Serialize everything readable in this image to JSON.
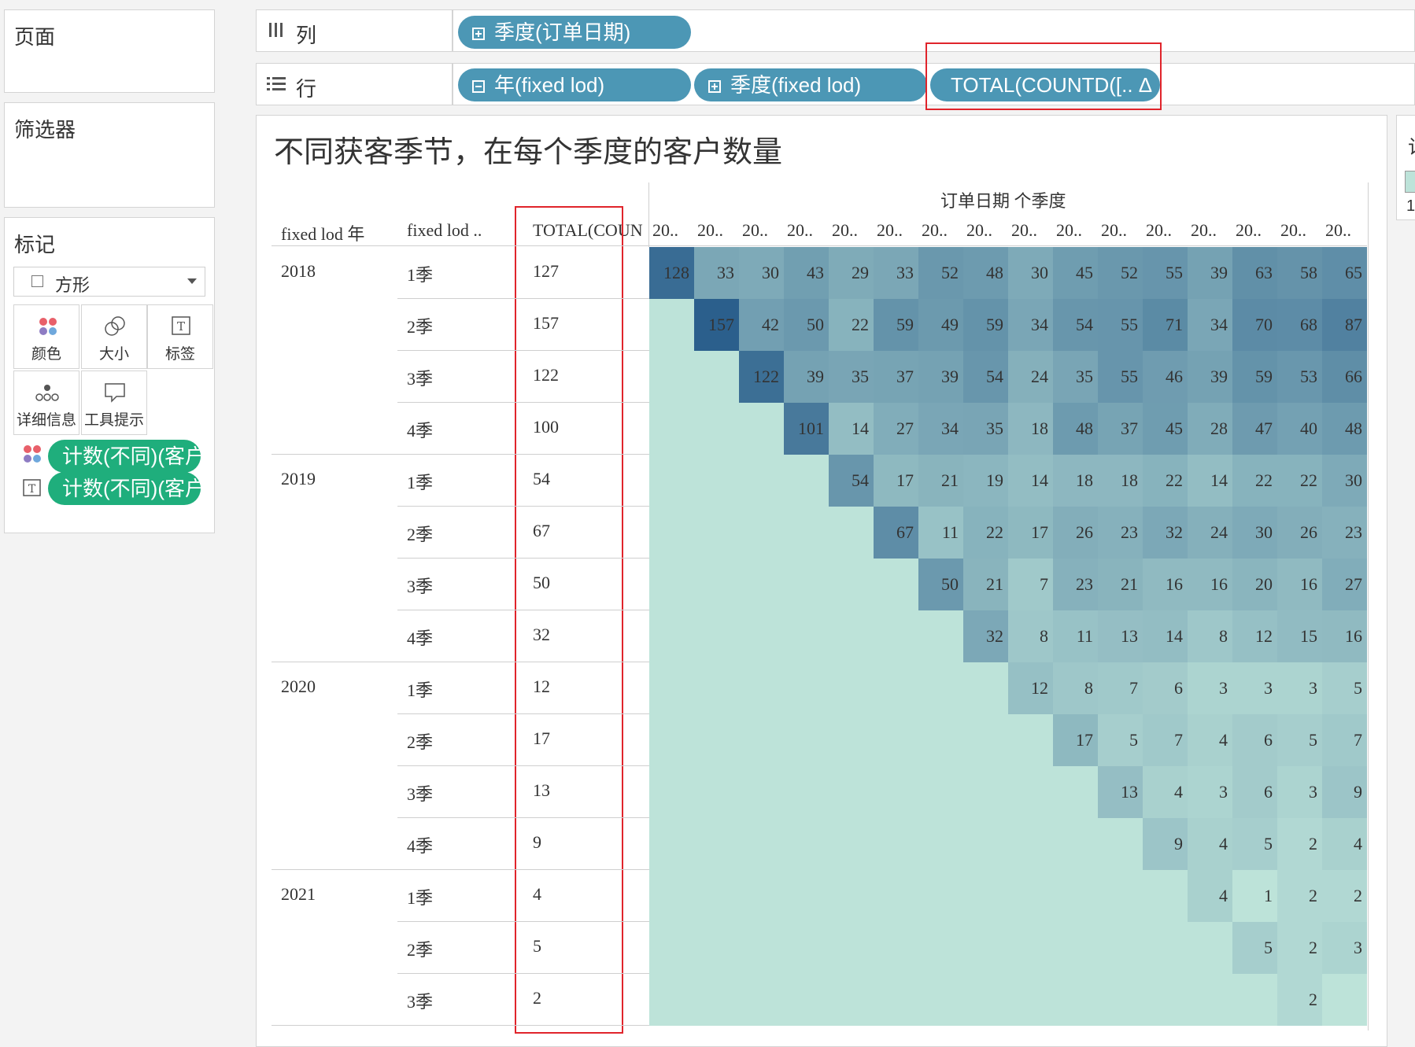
{
  "pages_panel": {
    "title": "页面"
  },
  "filters_panel": {
    "title": "筛选器"
  },
  "marks_panel": {
    "title": "标记",
    "mark_type": "方形",
    "buttons": [
      {
        "label": "颜色",
        "icon": "color-dots-icon"
      },
      {
        "label": "大小",
        "icon": "size-icon"
      },
      {
        "label": "标签",
        "icon": "label-icon"
      },
      {
        "label": "详细信息",
        "icon": "detail-icon"
      },
      {
        "label": "工具提示",
        "icon": "tooltip-icon"
      }
    ],
    "fields": [
      {
        "icon": "color-dots-icon",
        "label": "计数(不同)(客户.."
      },
      {
        "icon": "label-icon",
        "label": "计数(不同)(客户.."
      }
    ]
  },
  "columns_shelf": {
    "label": "列",
    "pills": [
      {
        "label": "季度(订单日期)",
        "icon": "plus"
      }
    ]
  },
  "rows_shelf": {
    "label": "行",
    "pills": [
      {
        "label": "年(fixed lod)",
        "icon": "minus"
      },
      {
        "label": "季度(fixed lod)",
        "icon": "plus"
      },
      {
        "label": "TOTAL(COUNTD([.. Δ",
        "icon": "none"
      }
    ]
  },
  "legend_stub": {
    "title": "计",
    "value": "1"
  },
  "view": {
    "title": "不同获客季节，在每个季度的客户数量",
    "col_header_title": "订单日期 个季度",
    "row_headers": [
      "fixed lod 年",
      "fixed lod ..",
      "TOTAL(COUN.."
    ],
    "col_labels": [
      "20..",
      "20..",
      "20..",
      "20..",
      "20..",
      "20..",
      "20..",
      "20..",
      "20..",
      "20..",
      "20..",
      "20..",
      "20..",
      "20..",
      "20..",
      "20.."
    ]
  },
  "chart_data": {
    "type": "heatmap",
    "title": "不同获客季节，在每个季度的客户数量",
    "columns_header": "订单日期 个季度",
    "row_groups": [
      {
        "year": "2018",
        "rows": [
          {
            "quarter": "1季",
            "total": "127",
            "values": [
              128,
              33,
              30,
              43,
              29,
              33,
              52,
              48,
              30,
              45,
              52,
              55,
              39,
              63,
              58,
              65
            ],
            "start": 0
          },
          {
            "quarter": "2季",
            "total": "157",
            "values": [
              157,
              42,
              50,
              22,
              59,
              49,
              59,
              34,
              54,
              55,
              71,
              34,
              70,
              68,
              87
            ],
            "start": 1
          },
          {
            "quarter": "3季",
            "total": "122",
            "values": [
              122,
              39,
              35,
              37,
              39,
              54,
              24,
              35,
              55,
              46,
              39,
              59,
              53,
              66
            ],
            "start": 2
          },
          {
            "quarter": "4季",
            "total": "100",
            "values": [
              101,
              14,
              27,
              34,
              35,
              18,
              48,
              37,
              45,
              28,
              47,
              40,
              48
            ],
            "start": 3
          }
        ]
      },
      {
        "year": "2019",
        "rows": [
          {
            "quarter": "1季",
            "total": "54",
            "values": [
              54,
              17,
              21,
              19,
              14,
              18,
              18,
              22,
              14,
              22,
              22,
              30
            ],
            "start": 4
          },
          {
            "quarter": "2季",
            "total": "67",
            "values": [
              67,
              11,
              22,
              17,
              26,
              23,
              32,
              24,
              30,
              26,
              23
            ],
            "start": 5
          },
          {
            "quarter": "3季",
            "total": "50",
            "values": [
              50,
              21,
              7,
              23,
              21,
              16,
              16,
              20,
              16,
              27
            ],
            "start": 6
          },
          {
            "quarter": "4季",
            "total": "32",
            "values": [
              32,
              8,
              11,
              13,
              14,
              8,
              12,
              15,
              16
            ],
            "start": 7
          }
        ]
      },
      {
        "year": "2020",
        "rows": [
          {
            "quarter": "1季",
            "total": "12",
            "values": [
              12,
              8,
              7,
              6,
              3,
              3,
              3,
              5
            ],
            "start": 8
          },
          {
            "quarter": "2季",
            "total": "17",
            "values": [
              17,
              5,
              7,
              4,
              6,
              5,
              7
            ],
            "start": 9
          },
          {
            "quarter": "3季",
            "total": "13",
            "values": [
              13,
              4,
              3,
              6,
              3,
              9
            ],
            "start": 10
          },
          {
            "quarter": "4季",
            "total": "9",
            "values": [
              9,
              4,
              5,
              2,
              4
            ],
            "start": 11
          }
        ]
      },
      {
        "year": "2021",
        "rows": [
          {
            "quarter": "1季",
            "total": "4",
            "values": [
              4,
              1,
              2,
              2
            ],
            "start": 12
          },
          {
            "quarter": "2季",
            "total": "5",
            "values": [
              5,
              2,
              3
            ],
            "start": 13
          },
          {
            "quarter": "3季",
            "total": "2",
            "values": [
              2
            ],
            "start": 14
          }
        ]
      }
    ],
    "color_range": [
      "#bde3d9",
      "#2b5f8c"
    ]
  }
}
